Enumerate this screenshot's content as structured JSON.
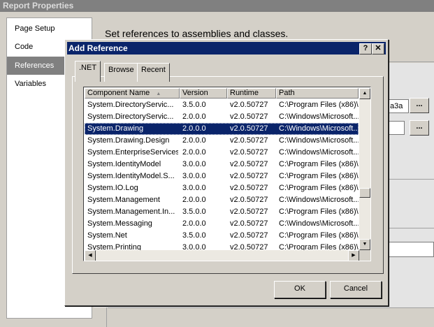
{
  "background": {
    "window_title": "Report Properties",
    "heading": "Set references to assemblies and classes.",
    "nav": [
      {
        "label": "Page Setup"
      },
      {
        "label": "Code"
      },
      {
        "label": "References",
        "selected": true
      },
      {
        "label": "Variables"
      }
    ],
    "partial_field_text": "a3a",
    "browse_label": "..."
  },
  "dialog": {
    "title": "Add Reference",
    "help_label": "?",
    "close_label": "✕",
    "tabs": [
      {
        "label": ".NET",
        "active": true
      },
      {
        "label": "Browse"
      },
      {
        "label": "Recent"
      }
    ],
    "columns": [
      "Component Name",
      "Version",
      "Runtime",
      "Path"
    ],
    "sort_indicator": "▲",
    "rows": [
      {
        "name": "System.DirectoryServic...",
        "version": "3.5.0.0",
        "runtime": "v2.0.50727",
        "path": "C:\\Program Files (x86)\\..."
      },
      {
        "name": "System.DirectoryServic...",
        "version": "2.0.0.0",
        "runtime": "v2.0.50727",
        "path": "C:\\Windows\\Microsoft..."
      },
      {
        "name": "System.Drawing",
        "version": "2.0.0.0",
        "runtime": "v2.0.50727",
        "path": "C:\\Windows\\Microsoft...",
        "selected": true
      },
      {
        "name": "System.Drawing.Design",
        "version": "2.0.0.0",
        "runtime": "v2.0.50727",
        "path": "C:\\Windows\\Microsoft..."
      },
      {
        "name": "System.EnterpriseServices",
        "version": "2.0.0.0",
        "runtime": "v2.0.50727",
        "path": "C:\\Windows\\Microsoft..."
      },
      {
        "name": "System.IdentityModel",
        "version": "3.0.0.0",
        "runtime": "v2.0.50727",
        "path": "C:\\Program Files (x86)\\..."
      },
      {
        "name": "System.IdentityModel.S...",
        "version": "3.0.0.0",
        "runtime": "v2.0.50727",
        "path": "C:\\Program Files (x86)\\..."
      },
      {
        "name": "System.IO.Log",
        "version": "3.0.0.0",
        "runtime": "v2.0.50727",
        "path": "C:\\Program Files (x86)\\..."
      },
      {
        "name": "System.Management",
        "version": "2.0.0.0",
        "runtime": "v2.0.50727",
        "path": "C:\\Windows\\Microsoft..."
      },
      {
        "name": "System.Management.In...",
        "version": "3.5.0.0",
        "runtime": "v2.0.50727",
        "path": "C:\\Program Files (x86)\\..."
      },
      {
        "name": "System.Messaging",
        "version": "2.0.0.0",
        "runtime": "v2.0.50727",
        "path": "C:\\Windows\\Microsoft..."
      },
      {
        "name": "System.Net",
        "version": "3.5.0.0",
        "runtime": "v2.0.50727",
        "path": "C:\\Program Files (x86)\\..."
      },
      {
        "name": "System.Printing",
        "version": "3.0.0.0",
        "runtime": "v2.0.50727",
        "path": "C:\\Program Files (x86)\\..."
      }
    ],
    "ok_label": "OK",
    "cancel_label": "Cancel",
    "scroll_up": "▲",
    "scroll_down": "▼",
    "scroll_left": "◀",
    "scroll_right": "▶"
  }
}
